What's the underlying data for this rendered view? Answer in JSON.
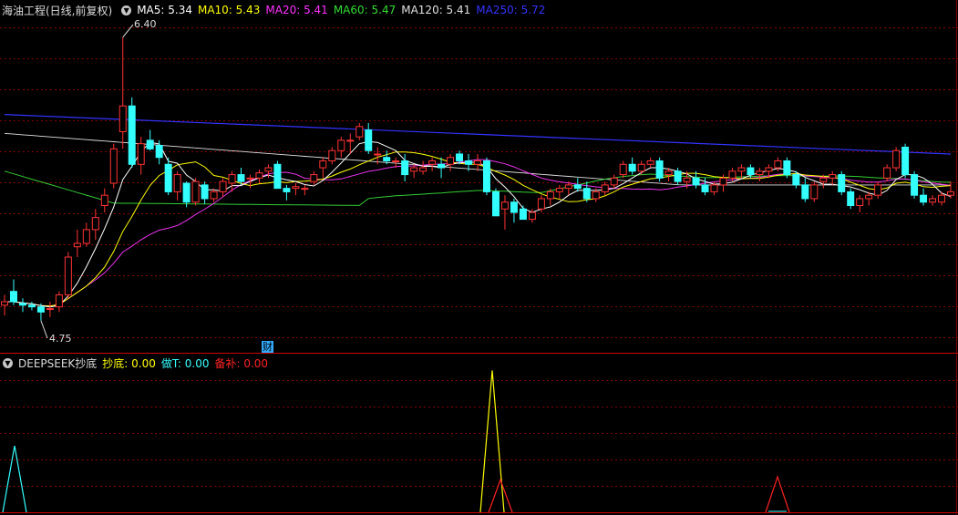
{
  "main_panel": {
    "title": "海油工程(日线,前复权)",
    "indicators": [
      {
        "label": "MA5: 5.34",
        "color": "#ffffff"
      },
      {
        "label": "MA10: 5.43",
        "color": "#ffff00"
      },
      {
        "label": "MA20: 5.41",
        "color": "#ff33ff"
      },
      {
        "label": "MA60: 5.47",
        "color": "#33dd33"
      },
      {
        "label": "MA120: 5.41",
        "color": "#e0e0e0"
      },
      {
        "label": "MA250: 5.72",
        "color": "#3333ff"
      }
    ],
    "high_label": "6.40",
    "low_label": "4.75",
    "cai_badge": "财"
  },
  "sub_panel": {
    "title": "DEEPSEEK抄底",
    "indicators": [
      {
        "label": "抄底: 0.00",
        "color": "#ffff00"
      },
      {
        "label": "做T: 0.00",
        "color": "#33ffff"
      },
      {
        "label": "备补: 0.00",
        "color": "#ff2222"
      }
    ]
  },
  "colors": {
    "up": "#ff3333",
    "down": "#33ffff",
    "grid": "#800000",
    "ma250": "#3333ff",
    "ma120": "#e0e0e0",
    "ma60": "#33cc33",
    "ma20": "#ee33ee",
    "ma10": "#ffff00",
    "ma5": "#ffffff"
  },
  "chart_data": {
    "type": "candlestick",
    "ylim": [
      4.6,
      6.5
    ],
    "candles": [
      [
        4.84,
        4.9,
        4.78,
        4.86
      ],
      [
        4.92,
        4.99,
        4.84,
        4.86
      ],
      [
        4.85,
        4.88,
        4.8,
        4.84
      ],
      [
        4.84,
        4.86,
        4.81,
        4.83
      ],
      [
        4.83,
        4.85,
        4.75,
        4.8
      ],
      [
        4.82,
        4.86,
        4.77,
        4.82
      ],
      [
        4.83,
        4.92,
        4.8,
        4.9
      ],
      [
        4.9,
        5.15,
        4.88,
        5.12
      ],
      [
        5.18,
        5.28,
        5.12,
        5.2
      ],
      [
        5.2,
        5.32,
        5.18,
        5.28
      ],
      [
        5.28,
        5.4,
        5.22,
        5.35
      ],
      [
        5.42,
        5.52,
        5.38,
        5.48
      ],
      [
        5.55,
        5.78,
        5.52,
        5.75
      ],
      [
        5.85,
        6.4,
        5.75,
        6.0
      ],
      [
        6.0,
        6.05,
        5.64,
        5.66
      ],
      [
        5.66,
        5.82,
        5.6,
        5.78
      ],
      [
        5.8,
        5.86,
        5.74,
        5.75
      ],
      [
        5.77,
        5.8,
        5.66,
        5.7
      ],
      [
        5.66,
        5.7,
        5.48,
        5.5
      ],
      [
        5.5,
        5.62,
        5.45,
        5.6
      ],
      [
        5.55,
        5.56,
        5.41,
        5.44
      ],
      [
        5.44,
        5.58,
        5.42,
        5.56
      ],
      [
        5.54,
        5.56,
        5.43,
        5.46
      ],
      [
        5.46,
        5.52,
        5.44,
        5.5
      ],
      [
        5.5,
        5.58,
        5.47,
        5.56
      ],
      [
        5.55,
        5.62,
        5.5,
        5.6
      ],
      [
        5.6,
        5.64,
        5.54,
        5.56
      ],
      [
        5.58,
        5.6,
        5.52,
        5.58
      ],
      [
        5.58,
        5.63,
        5.55,
        5.61
      ],
      [
        5.62,
        5.66,
        5.58,
        5.64
      ],
      [
        5.66,
        5.68,
        5.52,
        5.52
      ],
      [
        5.52,
        5.54,
        5.45,
        5.5
      ],
      [
        5.52,
        5.55,
        5.48,
        5.53
      ],
      [
        5.52,
        5.54,
        5.48,
        5.52
      ],
      [
        5.56,
        5.62,
        5.54,
        5.6
      ],
      [
        5.64,
        5.7,
        5.58,
        5.68
      ],
      [
        5.68,
        5.76,
        5.66,
        5.74
      ],
      [
        5.74,
        5.82,
        5.7,
        5.8
      ],
      [
        5.8,
        5.84,
        5.72,
        5.8
      ],
      [
        5.82,
        5.9,
        5.8,
        5.88
      ],
      [
        5.86,
        5.9,
        5.72,
        5.74
      ],
      [
        5.72,
        5.76,
        5.66,
        5.72
      ],
      [
        5.7,
        5.74,
        5.66,
        5.68
      ],
      [
        5.68,
        5.7,
        5.64,
        5.68
      ],
      [
        5.68,
        5.72,
        5.56,
        5.6
      ],
      [
        5.62,
        5.66,
        5.58,
        5.64
      ],
      [
        5.62,
        5.68,
        5.6,
        5.64
      ],
      [
        5.66,
        5.7,
        5.62,
        5.68
      ],
      [
        5.66,
        5.7,
        5.58,
        5.64
      ],
      [
        5.66,
        5.72,
        5.62,
        5.7
      ],
      [
        5.72,
        5.74,
        5.66,
        5.68
      ],
      [
        5.68,
        5.72,
        5.62,
        5.66
      ],
      [
        5.66,
        5.72,
        5.62,
        5.68
      ],
      [
        5.68,
        5.7,
        5.48,
        5.5
      ],
      [
        5.5,
        5.52,
        5.36,
        5.36
      ],
      [
        5.4,
        5.48,
        5.28,
        5.44
      ],
      [
        5.44,
        5.46,
        5.32,
        5.38
      ],
      [
        5.4,
        5.42,
        5.34,
        5.34
      ],
      [
        5.34,
        5.4,
        5.32,
        5.38
      ],
      [
        5.4,
        5.48,
        5.38,
        5.46
      ],
      [
        5.46,
        5.52,
        5.42,
        5.5
      ],
      [
        5.5,
        5.54,
        5.46,
        5.52
      ],
      [
        5.52,
        5.56,
        5.48,
        5.54
      ],
      [
        5.54,
        5.58,
        5.5,
        5.52
      ],
      [
        5.52,
        5.56,
        5.44,
        5.46
      ],
      [
        5.46,
        5.52,
        5.44,
        5.5
      ],
      [
        5.5,
        5.56,
        5.48,
        5.54
      ],
      [
        5.54,
        5.6,
        5.52,
        5.58
      ],
      [
        5.6,
        5.68,
        5.58,
        5.66
      ],
      [
        5.66,
        5.7,
        5.6,
        5.62
      ],
      [
        5.62,
        5.68,
        5.6,
        5.66
      ],
      [
        5.66,
        5.7,
        5.64,
        5.68
      ],
      [
        5.68,
        5.7,
        5.56,
        5.58
      ],
      [
        5.6,
        5.64,
        5.56,
        5.62
      ],
      [
        5.62,
        5.64,
        5.54,
        5.56
      ],
      [
        5.56,
        5.62,
        5.52,
        5.58
      ],
      [
        5.58,
        5.62,
        5.52,
        5.54
      ],
      [
        5.54,
        5.58,
        5.48,
        5.5
      ],
      [
        5.5,
        5.56,
        5.48,
        5.54
      ],
      [
        5.54,
        5.6,
        5.5,
        5.58
      ],
      [
        5.58,
        5.64,
        5.56,
        5.62
      ],
      [
        5.62,
        5.66,
        5.58,
        5.64
      ],
      [
        5.64,
        5.66,
        5.58,
        5.6
      ],
      [
        5.6,
        5.64,
        5.56,
        5.62
      ],
      [
        5.62,
        5.66,
        5.58,
        5.64
      ],
      [
        5.64,
        5.7,
        5.62,
        5.68
      ],
      [
        5.68,
        5.7,
        5.58,
        5.6
      ],
      [
        5.6,
        5.62,
        5.52,
        5.54
      ],
      [
        5.54,
        5.58,
        5.44,
        5.46
      ],
      [
        5.46,
        5.56,
        5.44,
        5.54
      ],
      [
        5.56,
        5.6,
        5.52,
        5.58
      ],
      [
        5.58,
        5.62,
        5.54,
        5.6
      ],
      [
        5.6,
        5.62,
        5.48,
        5.5
      ],
      [
        5.5,
        5.52,
        5.4,
        5.42
      ],
      [
        5.42,
        5.48,
        5.38,
        5.46
      ],
      [
        5.46,
        5.5,
        5.42,
        5.48
      ],
      [
        5.48,
        5.56,
        5.46,
        5.54
      ],
      [
        5.58,
        5.66,
        5.56,
        5.64
      ],
      [
        5.64,
        5.76,
        5.62,
        5.74
      ],
      [
        5.76,
        5.78,
        5.58,
        5.6
      ],
      [
        5.6,
        5.62,
        5.46,
        5.48
      ],
      [
        5.48,
        5.52,
        5.42,
        5.44
      ],
      [
        5.44,
        5.48,
        5.42,
        5.46
      ],
      [
        5.44,
        5.5,
        5.42,
        5.48
      ],
      [
        5.48,
        5.56,
        5.46,
        5.5
      ]
    ],
    "ma250": {
      "start": 5.95,
      "end": 5.72
    },
    "signals": {
      "zuoT": [
        {
          "index": 1,
          "value": 0.45
        },
        {
          "index": 76,
          "value": 0.02
        }
      ],
      "chaodi": [
        {
          "index": 69,
          "value": 0.96
        }
      ],
      "beibu": [
        {
          "index": 70,
          "value": 0.22
        },
        {
          "index": 110,
          "value": 0.24
        }
      ]
    }
  }
}
